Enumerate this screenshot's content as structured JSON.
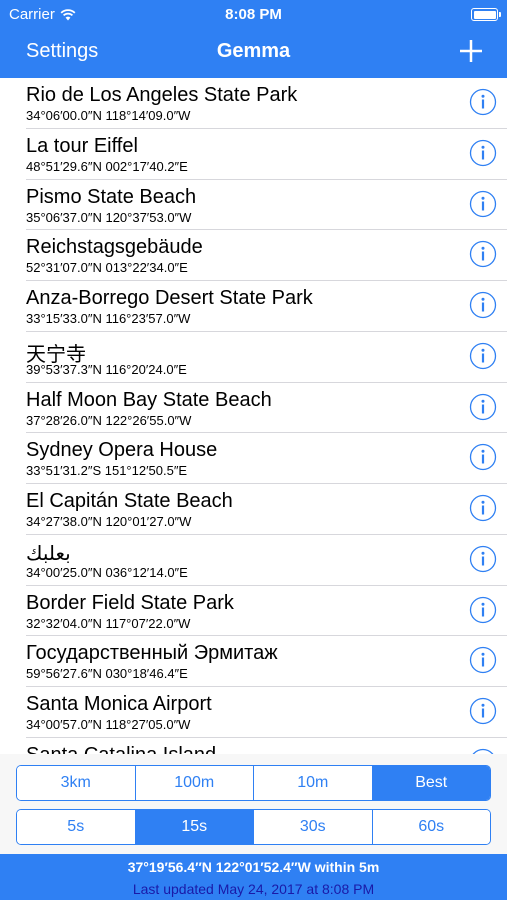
{
  "status_bar": {
    "carrier": "Carrier",
    "time": "8:08 PM",
    "battery_level": 1.0
  },
  "nav": {
    "left_label": "Settings",
    "title": "Gemma",
    "right_icon": "plus-icon"
  },
  "places": [
    {
      "name": "Rio de Los Angeles State Park",
      "coords": "34°06′00.0″N 118°14′09.0″W"
    },
    {
      "name": "La tour Eiffel",
      "coords": "48°51′29.6″N 002°17′40.2″E"
    },
    {
      "name": "Pismo State Beach",
      "coords": "35°06′37.0″N 120°37′53.0″W"
    },
    {
      "name": "Reichstagsgebäude",
      "coords": "52°31′07.0″N 013°22′34.0″E"
    },
    {
      "name": "Anza-Borrego Desert State Park",
      "coords": "33°15′33.0″N 116°23′57.0″W"
    },
    {
      "name": "天宁寺",
      "coords": "39°53′37.3″N 116°20′24.0″E"
    },
    {
      "name": "Half Moon Bay State Beach",
      "coords": "37°28′26.0″N 122°26′55.0″W"
    },
    {
      "name": "Sydney Opera House",
      "coords": "33°51′31.2″S 151°12′50.5″E"
    },
    {
      "name": "El Capitán State Beach",
      "coords": "34°27′38.0″N 120°01′27.0″W"
    },
    {
      "name": "بعلبك",
      "coords": "34°00′25.0″N 036°12′14.0″E"
    },
    {
      "name": "Border Field State Park",
      "coords": "32°32′04.0″N 117°07′22.0″W"
    },
    {
      "name": "Государственный Эрмитаж",
      "coords": "59°56′27.6″N 030°18′46.4″E"
    },
    {
      "name": "Santa Monica Airport",
      "coords": "34°00′57.0″N 118°27′05.0″W"
    },
    {
      "name": "Santa Catalina Island",
      "coords": ""
    }
  ],
  "distance_segments": {
    "options": [
      "3km",
      "100m",
      "10m",
      "Best"
    ],
    "selected": "Best"
  },
  "interval_segments": {
    "options": [
      "5s",
      "15s",
      "30s",
      "60s"
    ],
    "selected": "15s"
  },
  "footer": {
    "location": "37°19′56.4″N 122°01′52.4″W within 5m",
    "last_updated": "Last updated May 24, 2017 at 8:08 PM"
  },
  "colors": {
    "accent": "#2f80f3",
    "updated_text": "#1a1aa8"
  }
}
